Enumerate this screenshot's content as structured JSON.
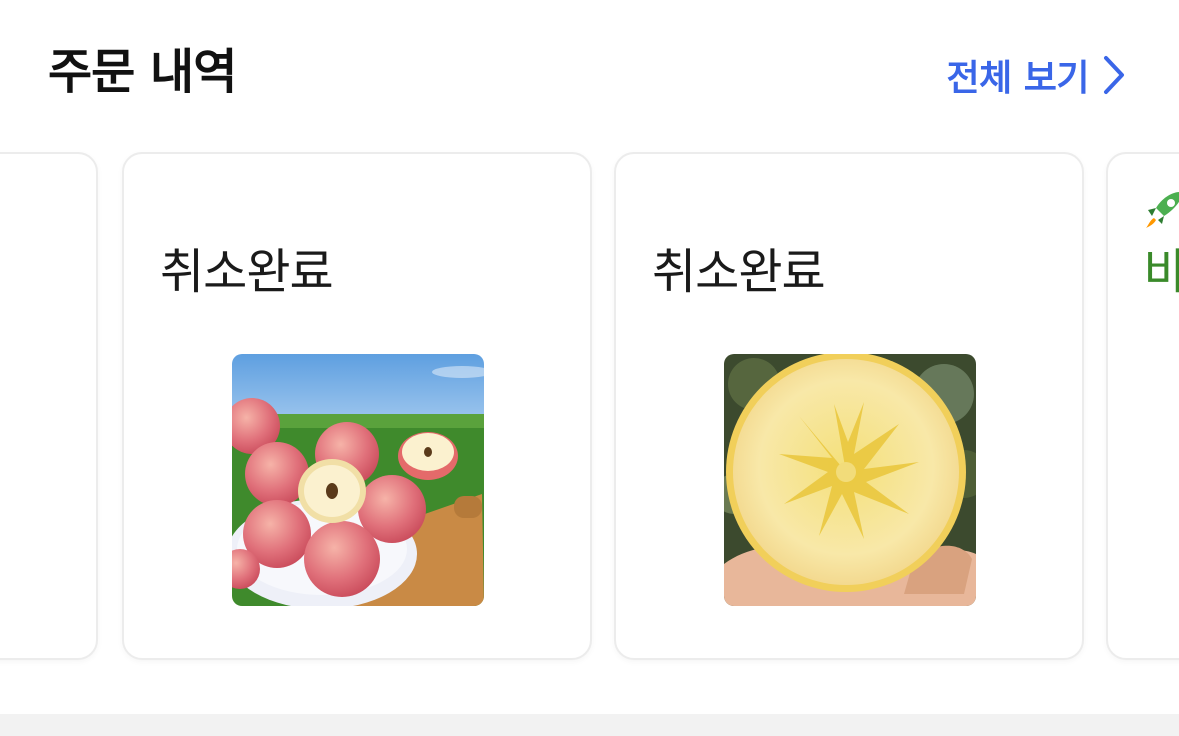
{
  "section": {
    "title": "주문 내역",
    "view_all_label": "전체 보기"
  },
  "orders": [
    {
      "status": "",
      "image": "none"
    },
    {
      "status": "취소완료",
      "image": "apples-on-grass-bowl"
    },
    {
      "status": "취소완료",
      "image": "apple-cross-section-in-hand"
    },
    {
      "status": "바",
      "image": "none",
      "badge_icon": "rocket-icon"
    }
  ],
  "colors": {
    "accent": "#3a66e8",
    "status_text": "#1a1a1a",
    "delivery_green": "#3a8a2a",
    "card_border": "#ececec",
    "footer_band": "#f2f2f2"
  }
}
